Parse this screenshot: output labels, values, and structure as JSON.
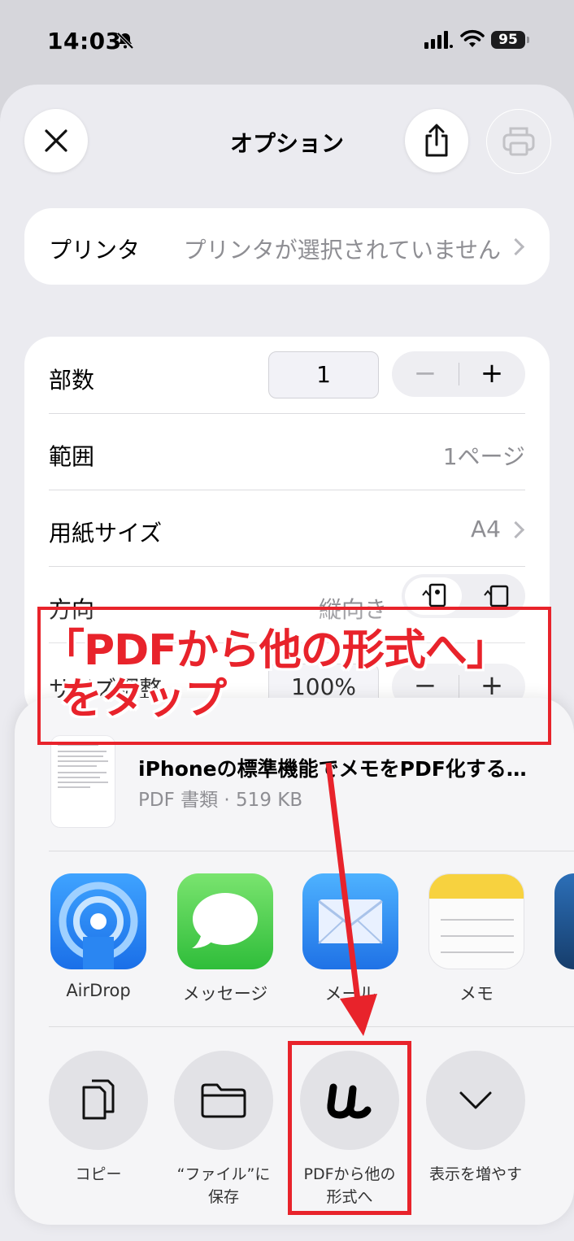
{
  "status_bar": {
    "time": "14:03",
    "battery": "95"
  },
  "sheet": {
    "title": "オプション"
  },
  "printer": {
    "label": "プリンタ",
    "value": "プリンタが選択されていません"
  },
  "options": {
    "copies_label": "部数",
    "copies_value": "1",
    "stepper_minus": "−",
    "stepper_plus": "+",
    "range_label": "範囲",
    "range_value": "1ページ",
    "paper_label": "用紙サイズ",
    "paper_value": "A4",
    "orientation_label": "方向",
    "orientation_value": "縦向き",
    "scale_label": "サイズ調整",
    "scale_value": "100%"
  },
  "share": {
    "doc_title": "iPhoneの標準機能でメモをPDF化する…",
    "doc_subtitle": "PDF 書類 · 519 KB",
    "apps": [
      {
        "name": "AirDrop",
        "icon": "airdrop-icon"
      },
      {
        "name": "メッセージ",
        "icon": "messages-icon"
      },
      {
        "name": "メール",
        "icon": "mail-icon"
      },
      {
        "name": "メモ",
        "icon": "notes-icon"
      }
    ],
    "actions": [
      {
        "name": "コピー",
        "icon": "copy-icon"
      },
      {
        "name_line1": "“ファイル”に",
        "name_line2": "保存",
        "icon": "folder-icon"
      },
      {
        "name_line1": "PDFから他の",
        "name_line2": "形式へ",
        "icon": "uPDF-icon"
      },
      {
        "name": "表示を増やす",
        "icon": "chevron-down-icon"
      }
    ]
  },
  "annotation": {
    "line1": "「PDFから他の形式へ」",
    "line2": "をタップ",
    "color": "#e8232b"
  }
}
